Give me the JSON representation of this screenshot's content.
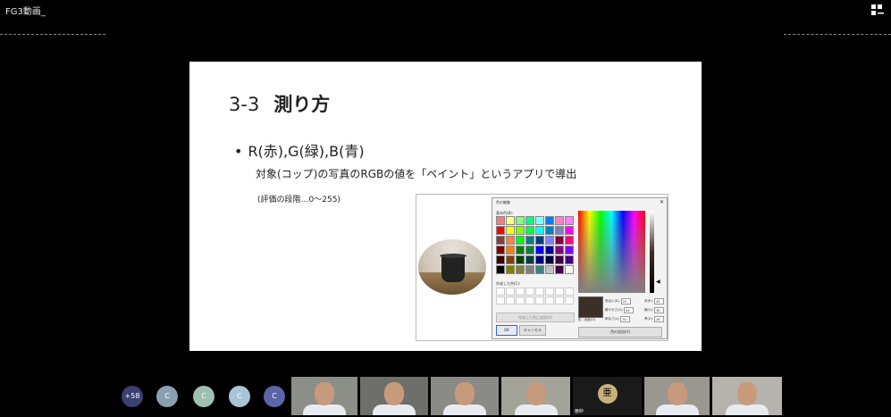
{
  "window": {
    "title": "FG3動画_"
  },
  "slide": {
    "number": "3-3",
    "heading": "測り方",
    "bullet": "R(赤),G(緑),B(青)",
    "subtext": "対象(コップ)の写真のRGBの値を「ペイント」というアプリで導出",
    "note": "(評価の段階…0〜255)"
  },
  "color_dialog": {
    "title": "色の編集",
    "basic_label": "基本色(B):",
    "custom_label": "作成した色(C):",
    "add_custom_label": "作成した色に追加(A)",
    "ok_label": "OK",
    "cancel_label": "キャンセル",
    "preview_label": "色｜純色(O)",
    "add_button_label": "色の追加(A)",
    "basic_colors": [
      "#f08080",
      "#ffff80",
      "#80ff80",
      "#00ff80",
      "#80ffff",
      "#0080ff",
      "#ff80c0",
      "#ff80ff",
      "#ff0000",
      "#ffff00",
      "#80ff00",
      "#00ff40",
      "#00ffff",
      "#0080c0",
      "#8080c0",
      "#ff00ff",
      "#804040",
      "#ff8040",
      "#00ff00",
      "#008080",
      "#004080",
      "#8080ff",
      "#800040",
      "#ff0080",
      "#800000",
      "#ff8000",
      "#008000",
      "#008040",
      "#0000ff",
      "#0000a0",
      "#800080",
      "#8000ff",
      "#400000",
      "#804000",
      "#004000",
      "#004040",
      "#000080",
      "#000040",
      "#400040",
      "#400080",
      "#000000",
      "#808000",
      "#808040",
      "#808080",
      "#408080",
      "#c0c0c0",
      "#400040",
      "#ffffff"
    ],
    "fields": [
      {
        "label": "色合い(E):",
        "value": "25",
        "label2": "赤(R):",
        "value2": "45"
      },
      {
        "label": "鮮やかさ(S):",
        "value": "64",
        "label2": "緑(G):",
        "value2": "38"
      },
      {
        "label": "明るさ(L):",
        "value": "30",
        "label2": "青(U):",
        "value2": "26"
      }
    ],
    "preview_color": "#3c2f26"
  },
  "participants": {
    "overflow_count": "+58",
    "avatars": [
      {
        "initial": "C",
        "color": "#8aa0b0"
      },
      {
        "initial": "C",
        "color": "#9ec0b0"
      },
      {
        "initial": "C",
        "color": "#a8c4d6"
      },
      {
        "initial": "C",
        "color": "#5a66a8"
      }
    ],
    "videos": [
      {
        "name": ""
      },
      {
        "name": ""
      },
      {
        "name": ""
      },
      {
        "name": ""
      },
      {
        "name": "亜紗",
        "initial": "亜"
      },
      {
        "name": ""
      },
      {
        "name": ""
      }
    ]
  }
}
